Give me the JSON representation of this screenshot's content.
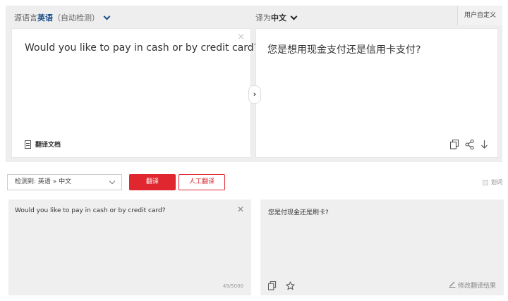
{
  "top": {
    "source_lang_prefix": "源语言",
    "source_lang": "英语",
    "source_lang_note": "（自动检测）",
    "target_lang_prefix": "译为",
    "target_lang": "中文",
    "custom_label": "用户自定义",
    "source_text": "Would you like to pay in cash or by credit card?",
    "clear_symbol": "×",
    "doc_label": "翻译文档",
    "swap_symbol": "›",
    "target_text": "您是想用现金支付还是信用卡支付?"
  },
  "bottom": {
    "detect_label": "检测到: 英语 » 中文",
    "translate_label": "翻译",
    "human_label": "人工翻译",
    "word_label": "划词",
    "input_text": "Would you like to pay in cash or by credit card?",
    "clear_symbol": "✕",
    "counter": "49/5000",
    "output_text": "您是付现金还是刷卡?",
    "edit_label": "修改翻译结果"
  },
  "icons": {
    "copy": "copy-icon",
    "share": "share-icon",
    "download": "download-icon",
    "star": "star-icon",
    "edit": "pencil-icon",
    "document": "document-icon"
  },
  "colors": {
    "accent_red": "#e0262e",
    "lang_blue": "#1a4f8a",
    "panel_bg": "#eeeeee"
  }
}
